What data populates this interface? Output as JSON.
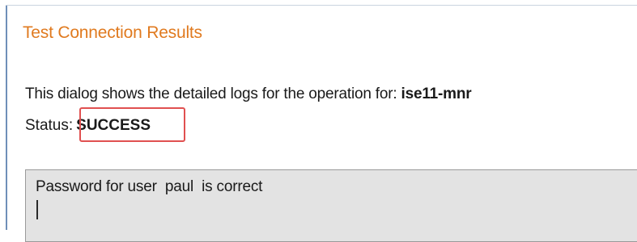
{
  "dialog": {
    "title": "Test Connection Results",
    "description_prefix": "This dialog shows the detailed logs for the operation for: ",
    "description_host": "ise11-mnr",
    "status_label": "Status:",
    "status_value": "SUCCESS",
    "log_text": "Password for user  paul  is correct"
  },
  "colors": {
    "title": "#e07a1f",
    "highlight": "#e05050",
    "log_background": "#e3e3e3"
  }
}
